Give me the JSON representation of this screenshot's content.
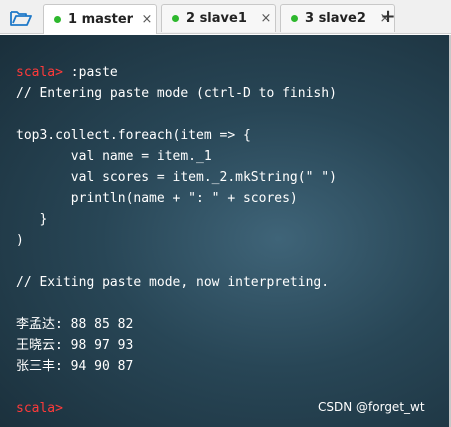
{
  "tabs": [
    {
      "label": "1 master",
      "status_color": "#2eb82e",
      "active": true
    },
    {
      "label": "2 slave1",
      "status_color": "#2eb82e",
      "active": false
    },
    {
      "label": "3 slave2",
      "status_color": "#2eb82e",
      "active": false
    }
  ],
  "close_glyph": "×",
  "new_tab_glyph": "+",
  "terminal": {
    "prompt": "scala>",
    "lines": {
      "cmd": " :paste",
      "l2": "// Entering paste mode (ctrl-D to finish)",
      "l4": "top3.collect.foreach(item => {",
      "l5": "       val name = item._1",
      "l6": "       val scores = item._2.mkString(\" \")",
      "l7": "       println(name + \": \" + scores)",
      "l8": "   }",
      "l9": ")",
      "l11": "// Exiting paste mode, now interpreting.",
      "r1": "李孟达: 88 85 82",
      "r2": "王晓云: 98 97 93",
      "r3": "张三丰: 94 90 87"
    }
  },
  "watermark": "CSDN @forget_wt",
  "colors": {
    "prompt": "#ff3a3a",
    "text": "#ffffff",
    "terminal_bg": "#284656",
    "status_dot": "#2eb82e"
  },
  "icons": {
    "folder": "folder-open-icon",
    "close": "close-icon",
    "add": "plus-icon"
  }
}
